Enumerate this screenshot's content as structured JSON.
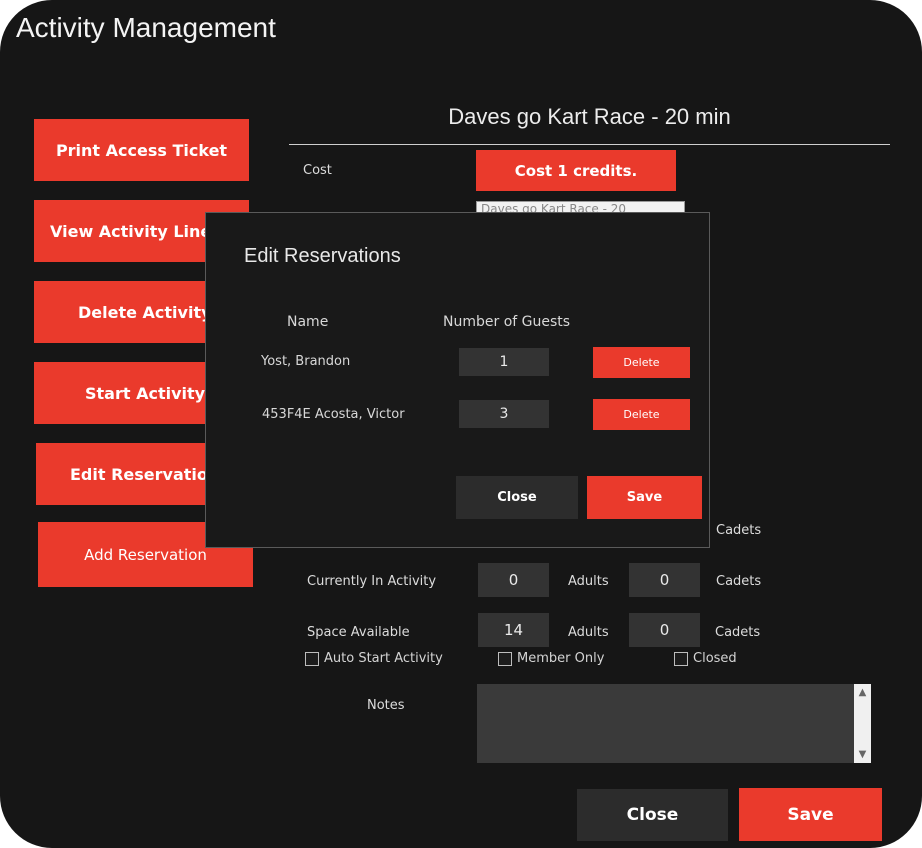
{
  "app": {
    "title": "Activity Management"
  },
  "sidebar": {
    "print_ticket": "Print Access Ticket",
    "view_lineup": "View Activity Lineup",
    "delete_activity": "Delete Activity",
    "start_activity": "Start Activity",
    "edit_reservations": "Edit Reservations",
    "add_reservation": "Add Reservation"
  },
  "activity": {
    "name": "Daves go Kart Race - 20 min",
    "cost_label": "Cost",
    "cost_button": "Cost 1 credits.",
    "name_field_value": "Daves go Kart Race - 20"
  },
  "counts": {
    "row1_cadets_label": "Cadets",
    "currently_label": "Currently In Activity",
    "currently_adults": "0",
    "currently_cadets": "0",
    "space_label": "Space Available",
    "space_adults": "14",
    "space_cadets": "0",
    "adults_label": "Adults",
    "cadets_label": "Cadets"
  },
  "options": {
    "auto_start": "Auto Start Activity",
    "member_only": "Member Only",
    "closed": "Closed"
  },
  "notes": {
    "label": "Notes"
  },
  "footer": {
    "close": "Close",
    "save": "Save"
  },
  "modal": {
    "title": "Edit Reservations",
    "col_name": "Name",
    "col_guests": "Number of Guests",
    "delete_label": "Delete",
    "rows": [
      {
        "name": "Yost, Brandon",
        "guests": "1"
      },
      {
        "name": "453F4E Acosta, Victor",
        "guests": "3"
      }
    ],
    "close": "Close",
    "save": "Save"
  },
  "colors": {
    "accent": "#ea3a2c",
    "background": "#161616",
    "field": "#333333"
  }
}
